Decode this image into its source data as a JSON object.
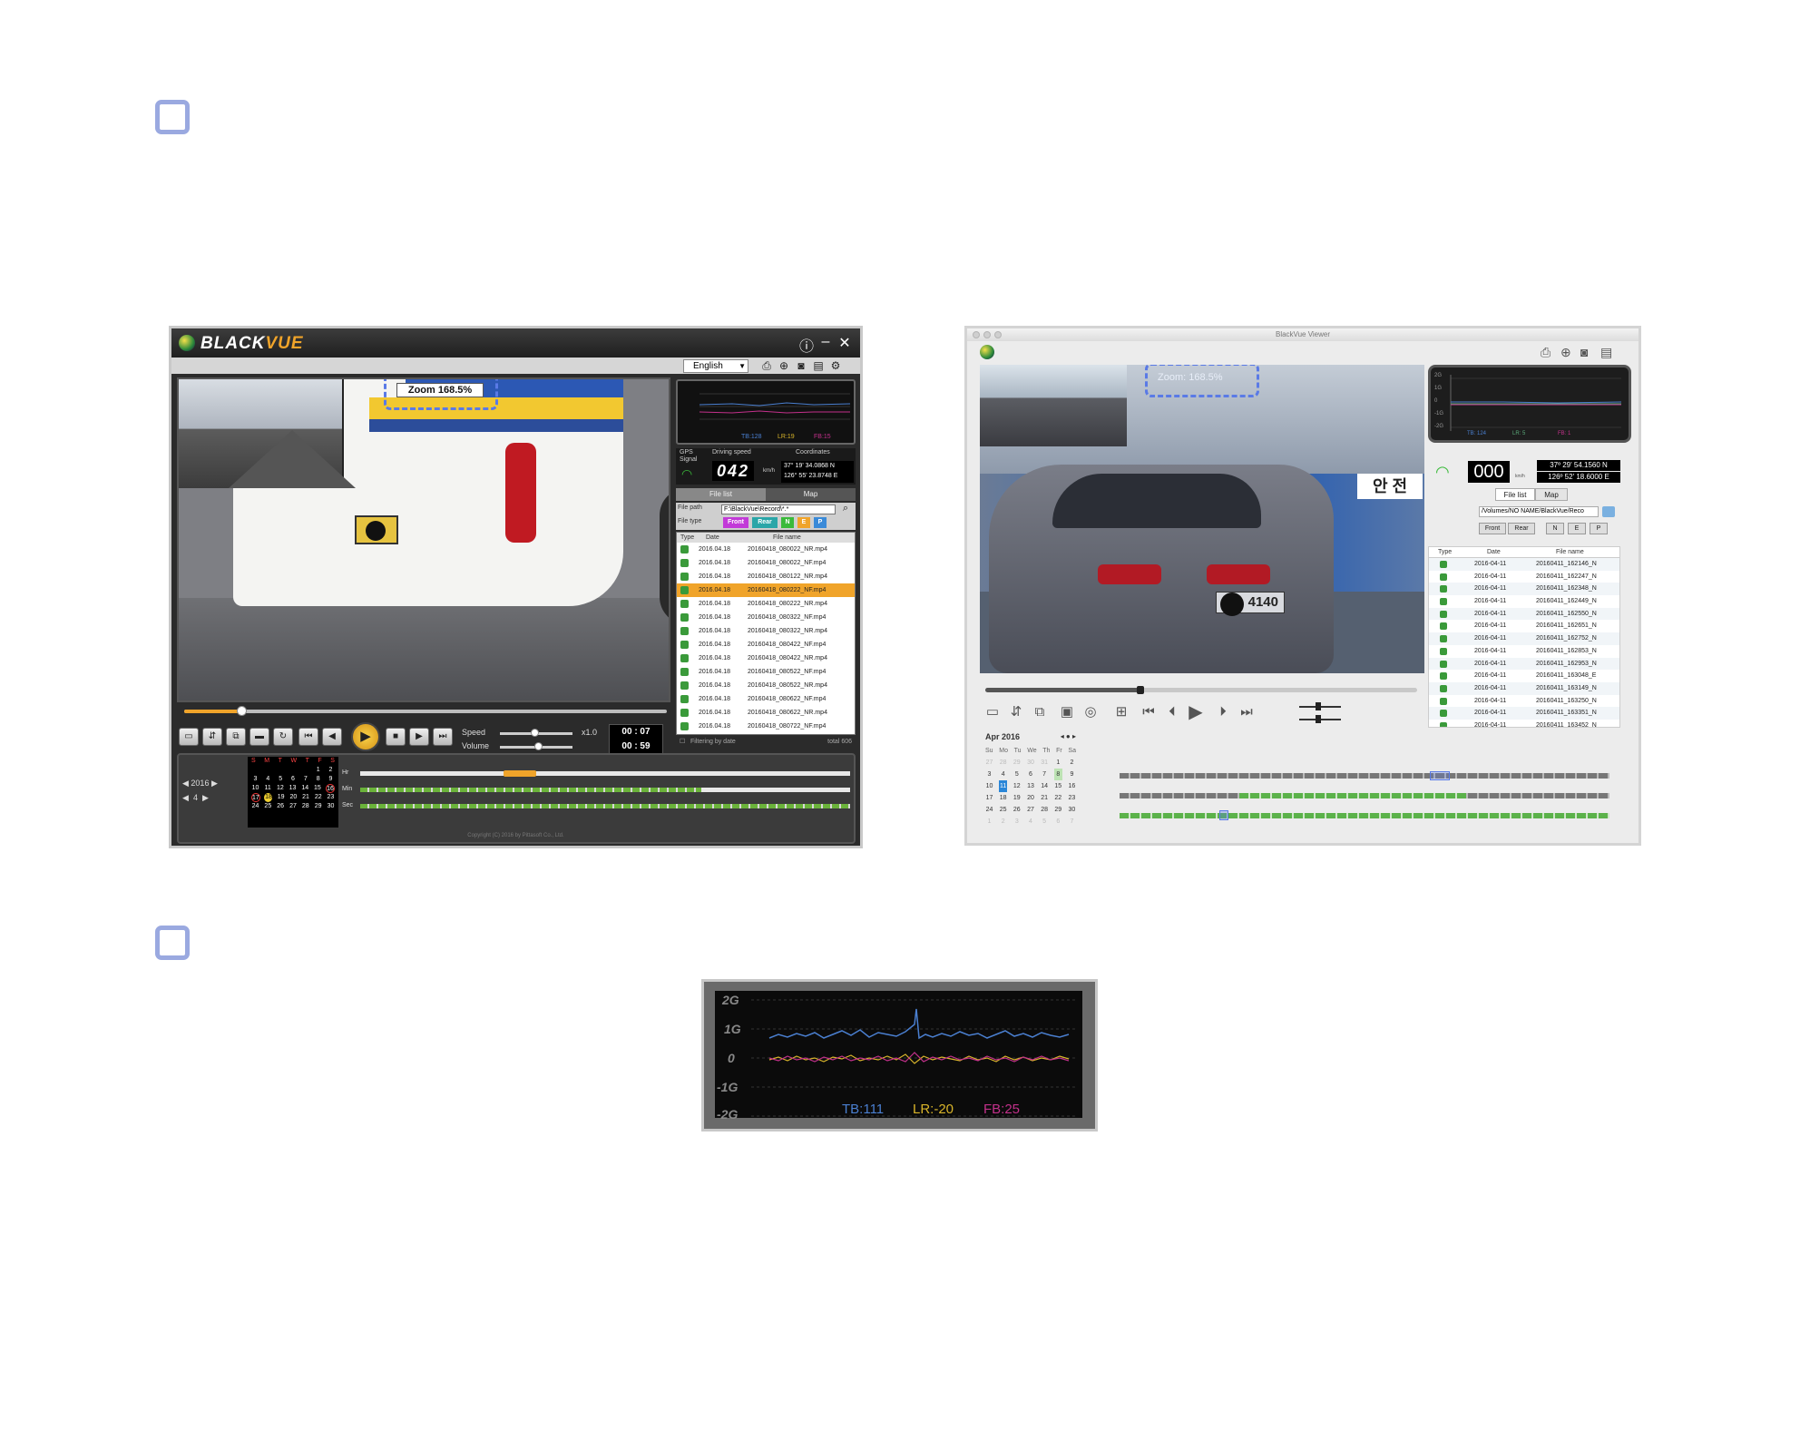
{
  "win_viewer": {
    "brand": "BLACK",
    "brand_accent": "VUE",
    "language": "English",
    "zoom_label": "Zoom 168.5%",
    "speed_label": "Speed",
    "speed_value": "x1.0",
    "volume_label": "Volume",
    "time_current": "00 : 07",
    "time_total": "00 : 59",
    "gps_label": "GPS Signal",
    "driving_speed_label": "Driving speed",
    "coordinates_label": "Coordinates",
    "speed_digits": "042",
    "speed_unit": "km/h",
    "lat": "37° 19' 34.0868 N",
    "lon": "126° 55' 23.8748 E",
    "tabs": [
      "File list",
      "Map"
    ],
    "file_path_label": "File path",
    "file_path": "F:\\BlackVue\\Record\\*.*",
    "file_type_label": "File type",
    "file_types": [
      "Front",
      "Rear",
      "N",
      "E",
      "P"
    ],
    "list_headers": [
      "Type",
      "Date",
      "File name"
    ],
    "files": [
      {
        "date": "2016.04.18",
        "name": "20160418_080022_NR.mp4",
        "selected": false
      },
      {
        "date": "2016.04.18",
        "name": "20160418_080022_NF.mp4",
        "selected": false
      },
      {
        "date": "2016.04.18",
        "name": "20160418_080122_NR.mp4",
        "selected": false
      },
      {
        "date": "2016.04.18",
        "name": "20160418_080222_NF.mp4",
        "selected": true
      },
      {
        "date": "2016.04.18",
        "name": "20160418_080222_NR.mp4",
        "selected": false
      },
      {
        "date": "2016.04.18",
        "name": "20160418_080322_NF.mp4",
        "selected": false
      },
      {
        "date": "2016.04.18",
        "name": "20160418_080322_NR.mp4",
        "selected": false
      },
      {
        "date": "2016.04.18",
        "name": "20160418_080422_NF.mp4",
        "selected": false
      },
      {
        "date": "2016.04.18",
        "name": "20160418_080422_NR.mp4",
        "selected": false
      },
      {
        "date": "2016.04.18",
        "name": "20160418_080522_NF.mp4",
        "selected": false
      },
      {
        "date": "2016.04.18",
        "name": "20160418_080522_NR.mp4",
        "selected": false
      },
      {
        "date": "2016.04.18",
        "name": "20160418_080622_NF.mp4",
        "selected": false
      },
      {
        "date": "2016.04.18",
        "name": "20160418_080622_NR.mp4",
        "selected": false
      },
      {
        "date": "2016.04.18",
        "name": "20160418_080722_NF.mp4",
        "selected": false
      }
    ],
    "filter_label": "Filtering by date",
    "total_label": "total 606",
    "year": "2016",
    "month": "4",
    "cal_head": [
      "S",
      "M",
      "T",
      "W",
      "T",
      "F",
      "S"
    ],
    "cal_rows": [
      [
        "",
        "",
        "",
        "",
        "",
        "1",
        "2"
      ],
      [
        "3",
        "4",
        "5",
        "6",
        "7",
        "8",
        "9"
      ],
      [
        "10",
        "11",
        "12",
        "13",
        "14",
        "15",
        "16"
      ],
      [
        "17",
        "18",
        "19",
        "20",
        "21",
        "22",
        "23"
      ],
      [
        "24",
        "25",
        "26",
        "27",
        "28",
        "29",
        "30"
      ]
    ],
    "track_labels": [
      "Hr",
      "Min",
      "Sec"
    ],
    "copyright": "Copyright (C) 2016 by Pittasoft Co., Ltd.",
    "gsensor_legend": [
      "TB:128",
      "LR:19",
      "FB:15"
    ]
  },
  "mac_viewer": {
    "window_title": "BlackVue Viewer",
    "zoom_label": "Zoom: 168.5%",
    "plate": "4140",
    "speed": "000",
    "speed_unit": "km/h",
    "lat": "37º 29' 54.1560 N",
    "lon": "126º 52' 18.6000 E",
    "tabs": [
      "File list",
      "Map"
    ],
    "path": "/Volumes/NO NAME/BlackVue/Reco",
    "file_types": [
      "Front",
      "Rear",
      "N",
      "E",
      "P"
    ],
    "list_headers": [
      "Type",
      "Date",
      "File name"
    ],
    "files": [
      {
        "date": "2016-04-11",
        "name": "20160411_162146_N"
      },
      {
        "date": "2016-04-11",
        "name": "20160411_162247_N"
      },
      {
        "date": "2016-04-11",
        "name": "20160411_162348_N"
      },
      {
        "date": "2016-04-11",
        "name": "20160411_162449_N"
      },
      {
        "date": "2016-04-11",
        "name": "20160411_162550_N"
      },
      {
        "date": "2016-04-11",
        "name": "20160411_162651_N"
      },
      {
        "date": "2016-04-11",
        "name": "20160411_162752_N"
      },
      {
        "date": "2016-04-11",
        "name": "20160411_162853_N"
      },
      {
        "date": "2016-04-11",
        "name": "20160411_162953_N"
      },
      {
        "date": "2016-04-11",
        "name": "20160411_163048_E"
      },
      {
        "date": "2016-04-11",
        "name": "20160411_163149_N"
      },
      {
        "date": "2016-04-11",
        "name": "20160411_163250_N"
      },
      {
        "date": "2016-04-11",
        "name": "20160411_163351_N"
      },
      {
        "date": "2016-04-11",
        "name": "20160411_163452_N"
      }
    ],
    "cal_title": "Apr 2016",
    "cal_head": [
      "Su",
      "Mo",
      "Tu",
      "We",
      "Th",
      "Fr",
      "Sa"
    ],
    "cal_rows": [
      [
        "27",
        "28",
        "29",
        "30",
        "31",
        "1",
        "2"
      ],
      [
        "3",
        "4",
        "5",
        "6",
        "7",
        "8",
        "9"
      ],
      [
        "10",
        "11",
        "12",
        "13",
        "14",
        "15",
        "16"
      ],
      [
        "17",
        "18",
        "19",
        "20",
        "21",
        "22",
        "23"
      ],
      [
        "24",
        "25",
        "26",
        "27",
        "28",
        "29",
        "30"
      ],
      [
        "1",
        "2",
        "3",
        "4",
        "5",
        "6",
        "7"
      ]
    ],
    "gsensor_axis": [
      "2G",
      "1G",
      "0",
      "-1G",
      "-2G"
    ],
    "gsensor_legend": [
      "TB: 124",
      "LR: 5",
      "FB: 1"
    ]
  },
  "gsensor_zoom": {
    "axis": [
      "2G",
      "1G",
      "0",
      "-1G",
      "-2G"
    ],
    "legend": [
      {
        "label": "TB:111",
        "color": "#4a7fd0"
      },
      {
        "label": "LR:-20",
        "color": "#d8b42a"
      },
      {
        "label": "FB:25",
        "color": "#c2308a"
      }
    ]
  },
  "colors": {
    "bullet": "#9aa9e0",
    "zoom_dash": "#5a7ae6",
    "accent": "#f0a42a"
  }
}
